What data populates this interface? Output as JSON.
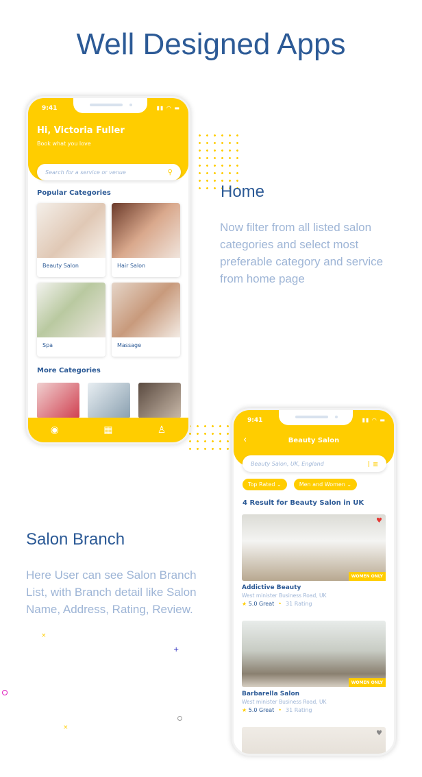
{
  "page_title": "Well Designed Apps",
  "home_section": {
    "heading": "Home",
    "description": "Now filter from all listed salon categories and select most preferable category and service from home page"
  },
  "branch_section": {
    "heading": "Salon Branch",
    "description": "Here User can see Salon Branch List, with Branch detail like Salon Name, Address, Rating, Review."
  },
  "phone_home": {
    "time": "9:41",
    "greeting": "Hi, Victoria Fuller",
    "subtitle": "Book what you love",
    "search_placeholder": "Search for a service or venue",
    "popular_title": "Popular Categories",
    "categories": [
      {
        "label": "Beauty Salon"
      },
      {
        "label": "Hair Salon"
      },
      {
        "label": "Spa"
      },
      {
        "label": "Massage"
      }
    ],
    "more_title": "More Categories",
    "nav_icons": [
      "compass-icon",
      "calendar-icon",
      "user-icon"
    ]
  },
  "phone_list": {
    "time": "9:41",
    "title": "Beauty Salon",
    "search_value": "Beauty Salon, UK, England",
    "filters": [
      "Top Rated",
      "Men and Women"
    ],
    "results_title": "4 Result for Beauty Salon in UK",
    "listings": [
      {
        "name": "Addictive Beauty",
        "address": "West minister Business Road, UK",
        "rating": "5.0 Great",
        "reviews": "31 Rating",
        "badge": "WOMEN ONLY"
      },
      {
        "name": "Barbarella Salon",
        "address": "West minister Business Road, UK",
        "rating": "5.0 Great",
        "reviews": "31 Rating",
        "badge": "WOMEN ONLY"
      }
    ]
  },
  "colors": {
    "accent": "#ffcd00",
    "primary": "#2c5a96",
    "muted": "#9eb5d6"
  }
}
